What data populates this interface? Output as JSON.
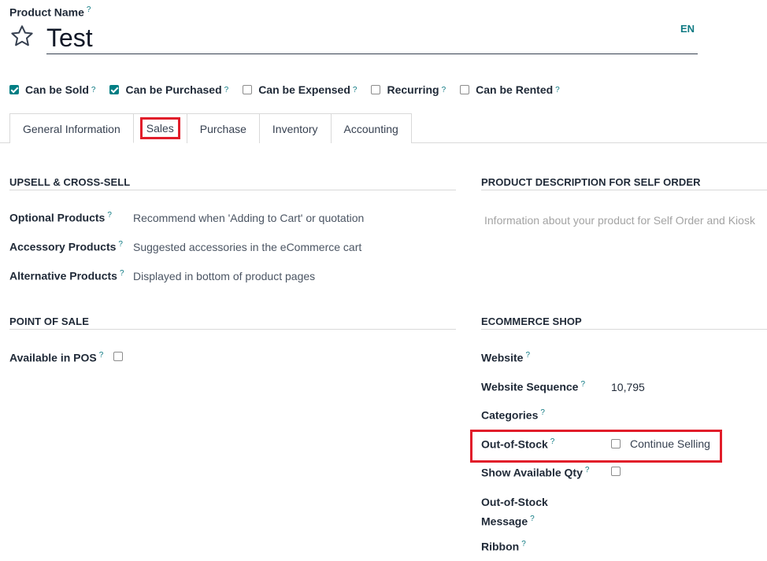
{
  "form": {
    "name_label": "Product Name",
    "help": "?",
    "product_name": "Test",
    "lang": "EN"
  },
  "options": [
    {
      "label": "Can be Sold",
      "checked": true
    },
    {
      "label": "Can be Purchased",
      "checked": true
    },
    {
      "label": "Can be Expensed",
      "checked": false
    },
    {
      "label": "Recurring",
      "checked": false
    },
    {
      "label": "Can be Rented",
      "checked": false
    }
  ],
  "tabs": [
    "General Information",
    "Sales",
    "Purchase",
    "Inventory",
    "Accounting"
  ],
  "upsell": {
    "title": "UPSELL & CROSS-SELL",
    "rows": [
      {
        "label": "Optional Products",
        "value": "Recommend when 'Adding to Cart' or quotation"
      },
      {
        "label": "Accessory Products",
        "value": "Suggested accessories in the eCommerce cart"
      },
      {
        "label": "Alternative Products",
        "value": "Displayed in bottom of product pages"
      }
    ]
  },
  "self_order": {
    "title": "PRODUCT DESCRIPTION FOR SELF ORDER",
    "placeholder": "Information about your product for Self Order and Kiosk"
  },
  "pos": {
    "title": "POINT OF SALE",
    "available_label": "Available in POS"
  },
  "ecommerce": {
    "title": "ECOMMERCE SHOP",
    "website_label": "Website",
    "sequence_label": "Website Sequence",
    "sequence_value": "10,795",
    "categories_label": "Categories",
    "out_of_stock_label": "Out-of-Stock",
    "continue_selling_label": "Continue Selling",
    "show_qty_label": "Show Available Qty",
    "oos_message_line1": "Out-of-Stock",
    "oos_message_line2": "Message",
    "ribbon_label": "Ribbon"
  },
  "colors": {
    "accent": "#017e84",
    "highlight": "#e11d2a"
  }
}
